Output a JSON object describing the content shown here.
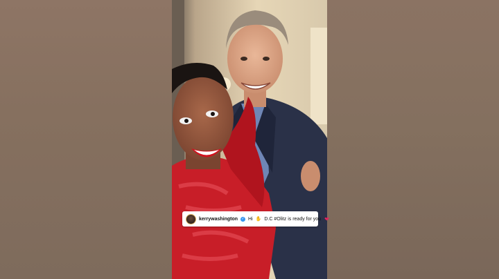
{
  "caption": {
    "username": "kerrywashington",
    "verified_glyph": "✓",
    "text_before": "Hi",
    "wave_glyph": "✋",
    "text_after": "D.C #Olitz is ready for you",
    "heart_glyph": "❤"
  },
  "icons": [
    "avatar",
    "verified-badge-icon",
    "waving-hand-icon",
    "red-heart-icon"
  ],
  "colors": {
    "blur_background": "#8a7060",
    "dress_red": "#c81e28",
    "suit_navy": "#2a3148",
    "caption_bg": "#ffffff",
    "heart": "#e0245e",
    "verified": "#3897f0"
  }
}
